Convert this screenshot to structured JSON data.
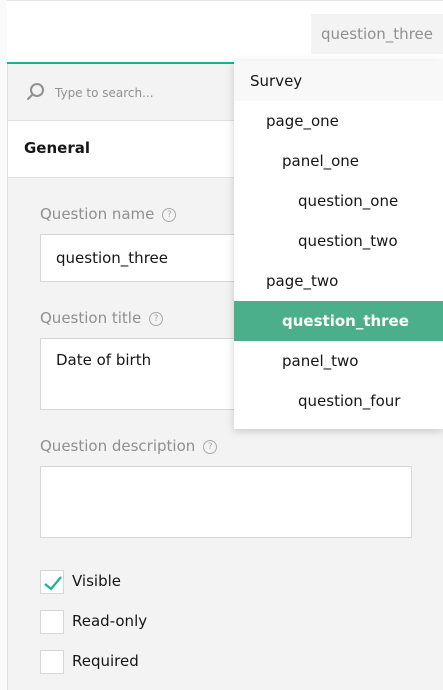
{
  "header": {
    "object_selector": "question_three"
  },
  "search": {
    "placeholder": "Type to search..."
  },
  "section": {
    "title": "General"
  },
  "fields": {
    "name": {
      "label": "Question name",
      "value": "question_three",
      "help": "?"
    },
    "title": {
      "label": "Question title",
      "value": "Date of birth",
      "help": "?"
    },
    "description": {
      "label": "Question description",
      "value": "",
      "help": "?"
    }
  },
  "checkboxes": [
    {
      "label": "Visible",
      "checked": true
    },
    {
      "label": "Read-only",
      "checked": false
    },
    {
      "label": "Required",
      "checked": false
    }
  ],
  "dropdown": {
    "items": [
      {
        "label": "Survey",
        "level": 0
      },
      {
        "label": "page_one",
        "level": 1
      },
      {
        "label": "panel_one",
        "level": 2
      },
      {
        "label": "question_one",
        "level": 3
      },
      {
        "label": "question_two",
        "level": 3
      },
      {
        "label": "page_two",
        "level": 1
      },
      {
        "label": "question_three",
        "level": 2,
        "selected": true
      },
      {
        "label": "panel_two",
        "level": 2
      },
      {
        "label": "question_four",
        "level": 3
      }
    ]
  },
  "colors": {
    "accent": "#19b394",
    "selected_item": "#4caf8c"
  },
  "icons": {
    "search": "search-icon",
    "help": "help-icon",
    "check": "check-icon"
  }
}
